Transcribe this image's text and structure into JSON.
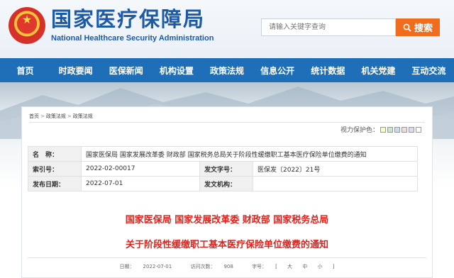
{
  "header": {
    "title": "国家医疗保障局",
    "subtitle": "National Healthcare Security Administration",
    "search_placeholder": "请输入关键字查询",
    "search_button": "搜索"
  },
  "nav": {
    "items": [
      "首页",
      "时政要闻",
      "医保新闻",
      "机构设置",
      "政策法规",
      "信息公开",
      "统计数据",
      "机关党建",
      "互动交流"
    ]
  },
  "breadcrumb": {
    "items": [
      "首页",
      "政策法规",
      "政策法规"
    ],
    "separator": ">"
  },
  "vision": {
    "label": "视力保护色：",
    "colors": [
      "#fafac8",
      "#c8e6c8",
      "#c8dcf0",
      "#f0dcdc",
      "#dcdcf0",
      "#ffffff"
    ]
  },
  "meta": {
    "name_label": "名　称：",
    "name_value": "国家医保局 国家发展改革委 财政部 国家税务总局关于阶段性缓缴职工基本医疗保险单位缴费的通知",
    "index_label": "索引号：",
    "index_value": "2022-02-00017",
    "docno_label": "发文字号：",
    "docno_value": "医保发〔2022〕21号",
    "date_label": "发布日期：",
    "date_value": "2022-07-01",
    "org_label": "发文机构：",
    "org_value": ""
  },
  "document": {
    "issuers": "国家医保局 国家发展改革委 财政部 国家税务总局",
    "title": "关于阶段性缓缴职工基本医疗保险单位缴费的通知"
  },
  "info": {
    "date_label": "日期：",
    "date": "2022-07-01",
    "views_label": "访问次数：",
    "views": "908",
    "fontsize_label": "字号：",
    "fs_open": "[",
    "fs_large": "大",
    "fs_medium": "中",
    "fs_small": "小",
    "fs_close": "]"
  }
}
